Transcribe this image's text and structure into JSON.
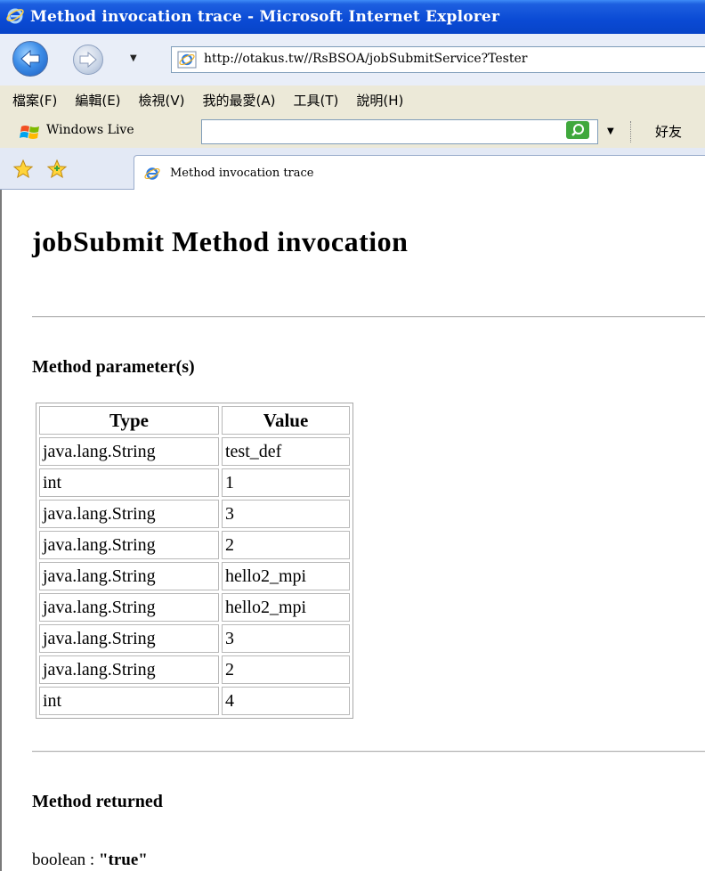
{
  "window": {
    "title": "Method invocation trace - Microsoft Internet Explorer"
  },
  "address_bar": {
    "url": "http://otakus.tw//RsBSOA/jobSubmitService?Tester"
  },
  "menu": {
    "items": [
      {
        "label": "檔案(F)"
      },
      {
        "label": "編輯(E)"
      },
      {
        "label": "檢視(V)"
      },
      {
        "label": "我的最愛(A)"
      },
      {
        "label": "工具(T)"
      },
      {
        "label": "說明(H)"
      }
    ]
  },
  "live_toolbar": {
    "brand": "Windows Live",
    "search_value": "",
    "friends_label": "好友"
  },
  "tab": {
    "label": "Method invocation trace"
  },
  "page": {
    "heading": "jobSubmit Method invocation",
    "params_heading": "Method parameter(s)",
    "table": {
      "headers": [
        "Type",
        "Value"
      ],
      "rows": [
        [
          "java.lang.String",
          "test_def"
        ],
        [
          "int",
          "1"
        ],
        [
          "java.lang.String",
          "3"
        ],
        [
          "java.lang.String",
          "2"
        ],
        [
          "java.lang.String",
          "hello2_mpi"
        ],
        [
          "java.lang.String",
          "hello2_mpi"
        ],
        [
          "java.lang.String",
          "3"
        ],
        [
          "java.lang.String",
          "2"
        ],
        [
          "int",
          "4"
        ]
      ]
    },
    "returned_heading": "Method returned",
    "return_type": "boolean : ",
    "return_value": "\"true\""
  },
  "colors": {
    "titlebar": "#0a4ad4",
    "menubar": "#ece9d8",
    "addressbar": "#e9eef8"
  },
  "icons": [
    "ie-logo-icon",
    "back-arrow-icon",
    "forward-arrow-icon",
    "page-icon",
    "windows-live-logo-icon",
    "search-go-icon",
    "favorites-star-icon",
    "add-favorites-icon"
  ]
}
